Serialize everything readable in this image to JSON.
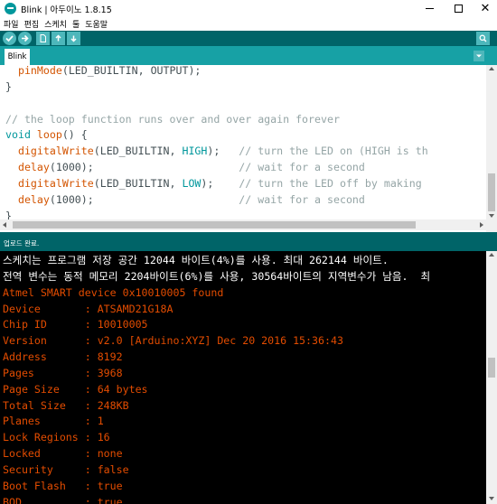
{
  "window": {
    "title": "Blink | 아두이노 1.8.15",
    "icon": "arduino-logo-icon",
    "minimize": "minimize-icon",
    "maximize": "maximize-icon",
    "close": "close-icon"
  },
  "menu": {
    "items": [
      "파일",
      "편집",
      "스케치",
      "툴",
      "도움말"
    ]
  },
  "toolbar": {
    "buttons": [
      "verify-icon",
      "upload-icon",
      "new-icon",
      "open-icon",
      "save-icon"
    ],
    "serial_monitor": "serial-monitor-icon",
    "accent": "#006468",
    "button_color": "#4db7bb"
  },
  "tabs": {
    "active": "Blink",
    "menu_icon": "tab-menu-icon",
    "bar_color": "#17a1a5"
  },
  "editor": {
    "lines": [
      [
        {
          "t": "  "
        },
        {
          "t": "pinMode",
          "c": "orange"
        },
        {
          "t": "(LED_BUILTIN, OUTPUT);"
        }
      ],
      [
        {
          "t": "}"
        }
      ],
      [
        {
          "t": ""
        }
      ],
      [
        {
          "t": "// the loop function runs over and over again forever",
          "c": "comment"
        }
      ],
      [
        {
          "t": "void",
          "c": "teal"
        },
        {
          "t": " "
        },
        {
          "t": "loop",
          "c": "orange"
        },
        {
          "t": "() {"
        }
      ],
      [
        {
          "t": "  "
        },
        {
          "t": "digitalWrite",
          "c": "orange"
        },
        {
          "t": "(LED_BUILTIN, "
        },
        {
          "t": "HIGH",
          "c": "teal"
        },
        {
          "t": ");   "
        },
        {
          "t": "// turn the LED on (HIGH is th",
          "c": "comment"
        }
      ],
      [
        {
          "t": "  "
        },
        {
          "t": "delay",
          "c": "orange"
        },
        {
          "t": "(1000);                       "
        },
        {
          "t": "// wait for a second",
          "c": "comment"
        }
      ],
      [
        {
          "t": "  "
        },
        {
          "t": "digitalWrite",
          "c": "orange"
        },
        {
          "t": "(LED_BUILTIN, "
        },
        {
          "t": "LOW",
          "c": "teal"
        },
        {
          "t": ");    "
        },
        {
          "t": "// turn the LED off by making",
          "c": "comment"
        }
      ],
      [
        {
          "t": "  "
        },
        {
          "t": "delay",
          "c": "orange"
        },
        {
          "t": "(1000);                       "
        },
        {
          "t": "// wait for a second",
          "c": "comment"
        }
      ],
      [
        {
          "t": "}"
        }
      ]
    ]
  },
  "status": {
    "text": "업로드 완료."
  },
  "console": {
    "lines": [
      {
        "text": "스케치는 프로그램 저장 공간 12044 바이트(4%)를 사용. 최대 262144 바이트.",
        "color": "white"
      },
      {
        "text": "전역 변수는 동적 메모리 2204바이트(6%)를 사용, 30564바이트의 지역변수가 남음.  최",
        "color": "white"
      },
      {
        "text": "Atmel SMART device 0x10010005 found",
        "color": "orange"
      },
      {
        "text": "Device       : ATSAMD21G18A",
        "color": "orange"
      },
      {
        "text": "Chip ID      : 10010005",
        "color": "orange"
      },
      {
        "text": "Version      : v2.0 [Arduino:XYZ] Dec 20 2016 15:36:43",
        "color": "orange"
      },
      {
        "text": "Address      : 8192",
        "color": "orange"
      },
      {
        "text": "Pages        : 3968",
        "color": "orange"
      },
      {
        "text": "Page Size    : 64 bytes",
        "color": "orange"
      },
      {
        "text": "Total Size   : 248KB",
        "color": "orange"
      },
      {
        "text": "Planes       : 1",
        "color": "orange"
      },
      {
        "text": "Lock Regions : 16",
        "color": "orange"
      },
      {
        "text": "Locked       : none",
        "color": "orange"
      },
      {
        "text": "Security     : false",
        "color": "orange"
      },
      {
        "text": "Boot Flash   : true",
        "color": "orange"
      },
      {
        "text": "BOD          : true",
        "color": "orange"
      }
    ]
  },
  "colors": {
    "keyword_orange": "#d35400",
    "keyword_teal": "#00979c",
    "comment": "#95a5a6",
    "console_orange": "#e34c00"
  }
}
